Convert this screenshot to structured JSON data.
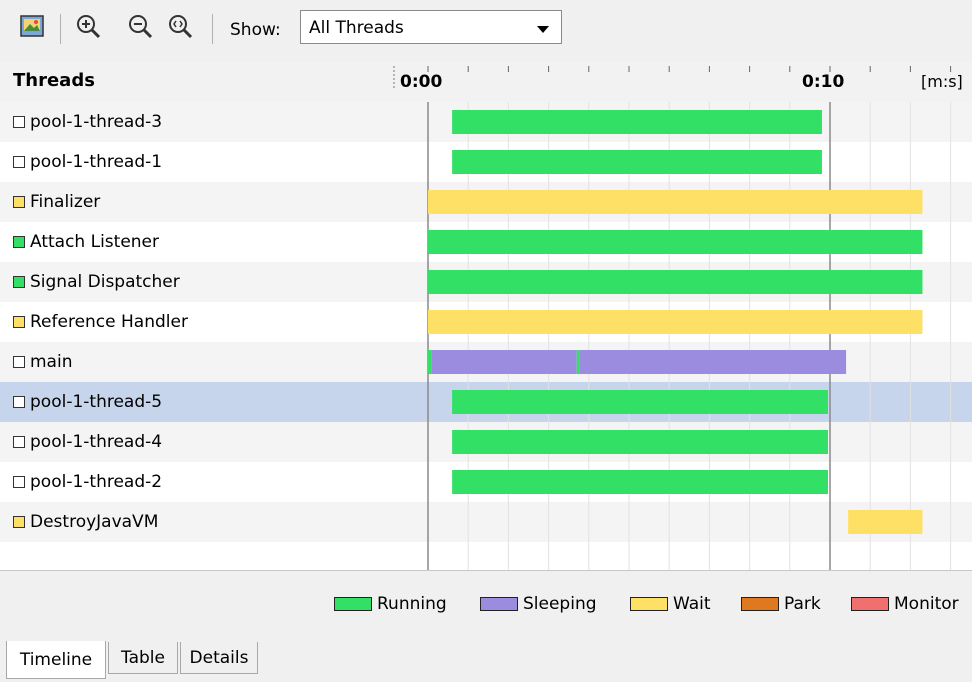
{
  "toolbar": {
    "show_label": "Show:",
    "thread_filter": "All Threads",
    "icons": [
      "snapshot-icon",
      "zoom-in-icon",
      "zoom-out-icon",
      "zoom-fit-icon"
    ]
  },
  "header": {
    "threads_title": "Threads",
    "time_unit": "[m:s]"
  },
  "timeline": {
    "tick_labels": [
      "0:00",
      "0:10"
    ],
    "unit_label": "[m:s]"
  },
  "state_colors": {
    "running": "#33e066",
    "sleeping": "#9b8ce0",
    "wait": "#ffe066",
    "park": "#e07820",
    "monitor": "#f07070"
  },
  "threads": [
    {
      "name": "pool-1-thread-3",
      "state_color": "#ffffff",
      "segments": [
        {
          "state": "running",
          "start": 0.6,
          "end": 9.8
        }
      ]
    },
    {
      "name": "pool-1-thread-1",
      "state_color": "#ffffff",
      "segments": [
        {
          "state": "running",
          "start": 0.6,
          "end": 9.8
        }
      ]
    },
    {
      "name": "Finalizer",
      "state_color": "#ffe066",
      "segments": [
        {
          "state": "wait",
          "start": 0.0,
          "end": 12.3
        }
      ]
    },
    {
      "name": "Attach Listener",
      "state_color": "#33e066",
      "segments": [
        {
          "state": "running",
          "start": 0.0,
          "end": 12.3
        }
      ]
    },
    {
      "name": "Signal Dispatcher",
      "state_color": "#33e066",
      "segments": [
        {
          "state": "running",
          "start": 0.0,
          "end": 12.3
        }
      ]
    },
    {
      "name": "Reference Handler",
      "state_color": "#ffe066",
      "segments": [
        {
          "state": "wait",
          "start": 0.0,
          "end": 12.3
        }
      ]
    },
    {
      "name": "main",
      "state_color": "#ffffff",
      "segments": [
        {
          "state": "running",
          "start": 0.0,
          "end": 0.08
        },
        {
          "state": "sleeping",
          "start": 0.08,
          "end": 3.7
        },
        {
          "state": "running",
          "start": 3.7,
          "end": 3.78
        },
        {
          "state": "sleeping",
          "start": 3.78,
          "end": 10.4
        }
      ]
    },
    {
      "name": "pool-1-thread-5",
      "state_color": "#ffffff",
      "selected": true,
      "segments": [
        {
          "state": "running",
          "start": 0.6,
          "end": 9.95
        }
      ]
    },
    {
      "name": "pool-1-thread-4",
      "state_color": "#ffffff",
      "segments": [
        {
          "state": "running",
          "start": 0.6,
          "end": 9.95
        }
      ]
    },
    {
      "name": "pool-1-thread-2",
      "state_color": "#ffffff",
      "segments": [
        {
          "state": "running",
          "start": 0.6,
          "end": 9.95
        }
      ]
    },
    {
      "name": "DestroyJavaVM",
      "state_color": "#ffe066",
      "segments": [
        {
          "state": "wait",
          "start": 10.45,
          "end": 12.3
        }
      ]
    }
  ],
  "legend": [
    {
      "label": "Running",
      "color": "#33e066"
    },
    {
      "label": "Sleeping",
      "color": "#9b8ce0"
    },
    {
      "label": "Wait",
      "color": "#ffe066"
    },
    {
      "label": "Park",
      "color": "#e07820"
    },
    {
      "label": "Monitor",
      "color": "#f07070"
    }
  ],
  "tabs": [
    {
      "label": "Timeline",
      "active": true
    },
    {
      "label": "Table",
      "active": false
    },
    {
      "label": "Details",
      "active": false
    }
  ]
}
